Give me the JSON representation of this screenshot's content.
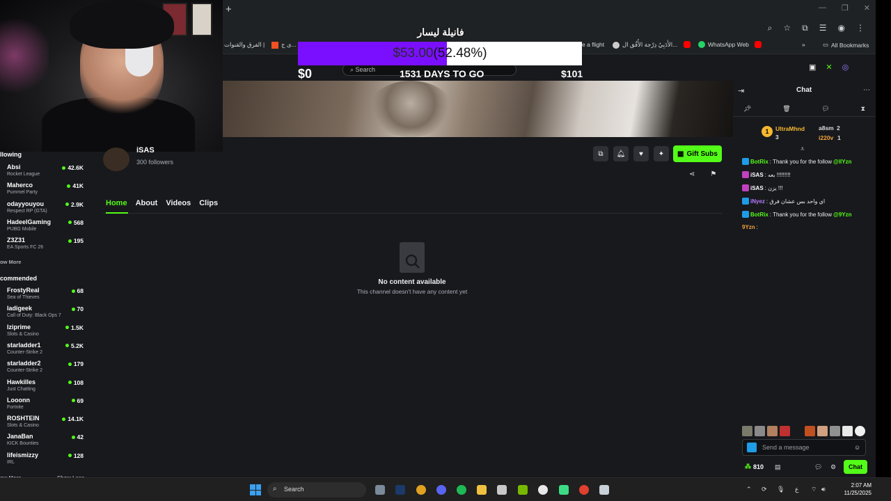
{
  "browser": {
    "bookmarks": [
      {
        "label": "الفرق والقنوات |",
        "color": "#888"
      },
      {
        "label": "ى ج...",
        "color": "#f25022"
      },
      {
        "label": "e a flight",
        "color": "#999"
      },
      {
        "label": "الأَدَبِيُ دِرْجة الأُفُق ال...",
        "color": "#ccc"
      },
      {
        "label": "WhatsApp Web",
        "color": "#25d366"
      }
    ],
    "all_bookmarks": "All Bookmarks"
  },
  "goal": {
    "title": "فانيلة ليسار",
    "raised": "$53.00",
    "percent_text": "(52.48%)",
    "fraction": 0.5248,
    "min": "$0",
    "max": "$101",
    "days": "1531 DAYS TO GO"
  },
  "header": {
    "search_placeholder": "Search"
  },
  "channel": {
    "name": "iSAS",
    "followers": "300 followers",
    "gift_label": "Gift Subs",
    "tabs": [
      "Home",
      "About",
      "Videos",
      "Clips"
    ],
    "empty_title": "No content available",
    "empty_sub": "This channel doesn't have any content yet"
  },
  "sidebar": {
    "following_title": "llowing",
    "following": [
      {
        "name": "Absi",
        "game": "Rocket League",
        "viewers": "42.6K"
      },
      {
        "name": "Maherco",
        "game": "Pummel Party",
        "viewers": "41K"
      },
      {
        "name": "odayyouyou",
        "game": "Respect RP (GTA)",
        "viewers": "2.9K"
      },
      {
        "name": "HadeelGaming",
        "game": "PUBG Mobile",
        "viewers": "568"
      },
      {
        "name": "Z3Z31",
        "game": "EA Sports FC 26",
        "viewers": "195"
      }
    ],
    "show_more": "ow More",
    "recommended_title": "commended",
    "recommended": [
      {
        "name": "FrostyReal",
        "game": "Sea of Thieves",
        "viewers": "68"
      },
      {
        "name": "ladigeek",
        "game": "Call of Duty: Black Ops 7",
        "viewers": "70"
      },
      {
        "name": "Iziprime",
        "game": "Slots & Casino",
        "viewers": "1.5K"
      },
      {
        "name": "starladder1",
        "game": "Counter-Strike 2",
        "viewers": "5.2K"
      },
      {
        "name": "starladder2",
        "game": "Counter-Strike 2",
        "viewers": "179"
      },
      {
        "name": "Hawkilles",
        "game": "Just Chatting",
        "viewers": "108"
      },
      {
        "name": "Looonn",
        "game": "Fortnite",
        "viewers": "69"
      },
      {
        "name": "ROSHTEIN",
        "game": "Slots & Casino",
        "viewers": "14.1K"
      },
      {
        "name": "JanaBan",
        "game": "KICK Bounties",
        "viewers": "42"
      },
      {
        "name": "lifeismizzy",
        "game": "IRL",
        "viewers": "128"
      }
    ],
    "show_more_bottom": "ow More",
    "show_less": "Show Less"
  },
  "chat": {
    "title": "Chat",
    "leaderboard": [
      {
        "name": "UltraMhnd",
        "count": "3"
      },
      {
        "name": "a8sm",
        "count": "2"
      },
      {
        "name": "i220v",
        "count": "1"
      }
    ],
    "messages": [
      {
        "user": "BotRix",
        "user_color": "#53fc18",
        "text": ": Thank you for the follow ",
        "mention": "@llYzn"
      },
      {
        "user": "iSAS",
        "user_color": "#ffffff",
        "text": ": بعه !!!!!!!!!",
        "mention": ""
      },
      {
        "user": "iSAS",
        "user_color": "#ffffff",
        "text": ": يزن !!!",
        "mention": ""
      },
      {
        "user": "iNyez",
        "user_color": "#b57bff",
        "text": ": اي واحد بس عشان فرق",
        "mention": ""
      },
      {
        "user": "BotRix",
        "user_color": "#53fc18",
        "text": ": Thank you for the follow ",
        "mention": "@9Yzn"
      },
      {
        "user": "9Yzn",
        "user_color": "#f2a33a",
        "text": ":",
        "mention": ""
      }
    ],
    "input_placeholder": "Send a message",
    "points": "810",
    "send_label": "Chat"
  },
  "taskbar": {
    "search": "Search",
    "time": "2:07 AM",
    "date": "11/25/2025",
    "lang": "ع"
  }
}
